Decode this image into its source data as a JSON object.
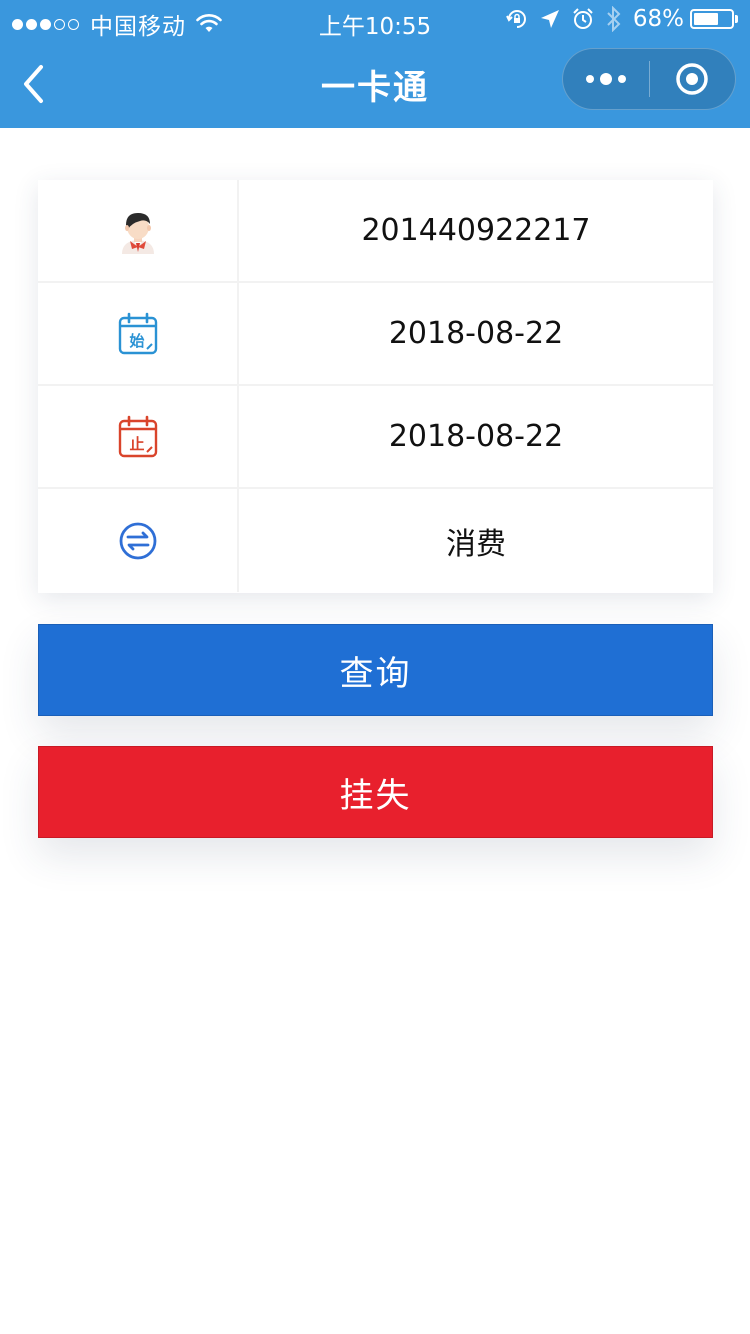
{
  "status_bar": {
    "carrier": "中国移动",
    "time": "上午10:55",
    "battery_percent": "68%",
    "battery_level": 0.68,
    "signal_bars_filled": 3,
    "signal_bars_total": 5
  },
  "nav": {
    "title": "一卡通",
    "back_icon": "chevron-left-icon",
    "more_icon": "more-dots-icon",
    "close_icon": "target-circle-icon"
  },
  "form": {
    "rows": [
      {
        "icon": "student-avatar-icon",
        "value": "201440922217"
      },
      {
        "icon": "calendar-start-icon",
        "icon_text": "始",
        "value": "2018-08-22"
      },
      {
        "icon": "calendar-end-icon",
        "icon_text": "止",
        "value": "2018-08-22"
      },
      {
        "icon": "exchange-icon",
        "value": "消费"
      }
    ]
  },
  "buttons": {
    "query_label": "查询",
    "report_lost_label": "挂失"
  },
  "colors": {
    "nav_bg": "#3a97dd",
    "query_button": "#1f6fd4",
    "lost_button": "#e8202d",
    "calendar_start": "#2a92d4",
    "calendar_end": "#d9442b",
    "exchange": "#2f6fd6"
  }
}
